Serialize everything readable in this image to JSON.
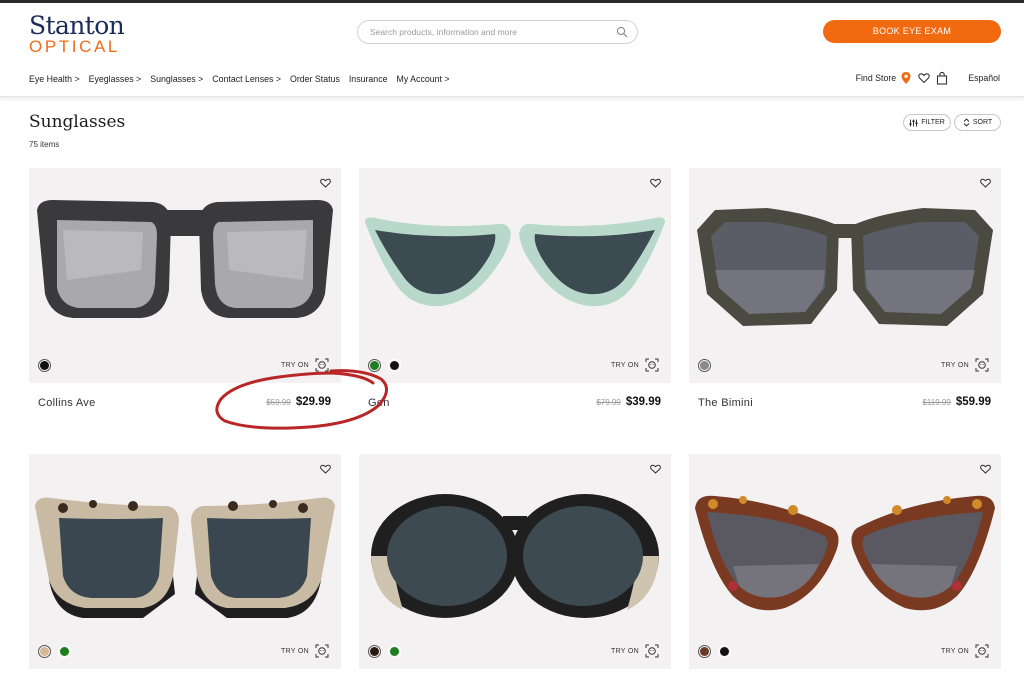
{
  "brand": {
    "logo_top": "Stanton",
    "logo_bottom": "OPTICAL",
    "primary_color": "#1b2c5a",
    "accent_color": "#f26a10"
  },
  "search": {
    "placeholder": "Search products, information and more",
    "icon": "search-icon"
  },
  "header": {
    "book_exam_label": "BOOK EYE EXAM"
  },
  "nav": {
    "items": [
      {
        "label": "Eye Health >"
      },
      {
        "label": "Eyeglasses >"
      },
      {
        "label": "Sunglasses >"
      },
      {
        "label": "Contact Lenses >"
      },
      {
        "label": "Order Status"
      },
      {
        "label": "Insurance"
      },
      {
        "label": "My Account >"
      }
    ],
    "find_store_label": "Find Store",
    "language_label": "Español"
  },
  "listing": {
    "title": "Sunglasses",
    "count": "75 items",
    "filter_label": "FILTER",
    "sort_label": "SORT",
    "try_on_label": "TRY ON"
  },
  "products": [
    {
      "name": "Collins Ave",
      "old_price": "$59.99",
      "price": "$29.99",
      "swatches": [
        "#111111"
      ]
    },
    {
      "name": "Gen",
      "old_price": "$79.99",
      "price": "$39.99",
      "swatches": [
        "#1e7d1e",
        "#111111"
      ]
    },
    {
      "name": "The Bimini",
      "old_price": "$119.99",
      "price": "$59.99",
      "swatches": [
        "#8a8a8a"
      ]
    },
    {
      "name": "",
      "old_price": "",
      "price": "",
      "swatches": [
        "#d8b894",
        "#1e7d1e"
      ]
    },
    {
      "name": "",
      "old_price": "",
      "price": "",
      "swatches": [
        "#2b1a14",
        "#1e7d1e"
      ]
    },
    {
      "name": "",
      "old_price": "",
      "price": "",
      "swatches": [
        "#6b3a25",
        "#111111"
      ]
    }
  ],
  "annotation_color": "#b82626"
}
